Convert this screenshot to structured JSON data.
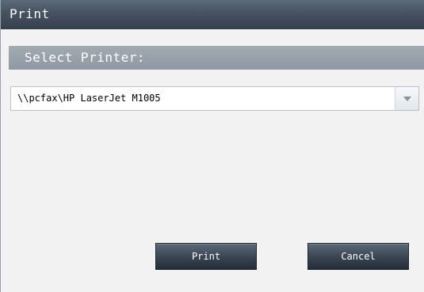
{
  "window": {
    "title": "Print"
  },
  "section": {
    "header": "Select Printer:"
  },
  "printer_select": {
    "selected": "\\\\pcfax\\HP LaserJet M1005",
    "arrow_icon": "chevron-down-icon"
  },
  "buttons": {
    "print_label": "Print",
    "cancel_label": "Cancel"
  },
  "colors": {
    "title_bar": "#46525f",
    "section_header": "#9aa2ab",
    "button": "#3e4a57",
    "dialog_background": "#f2f2f2"
  }
}
